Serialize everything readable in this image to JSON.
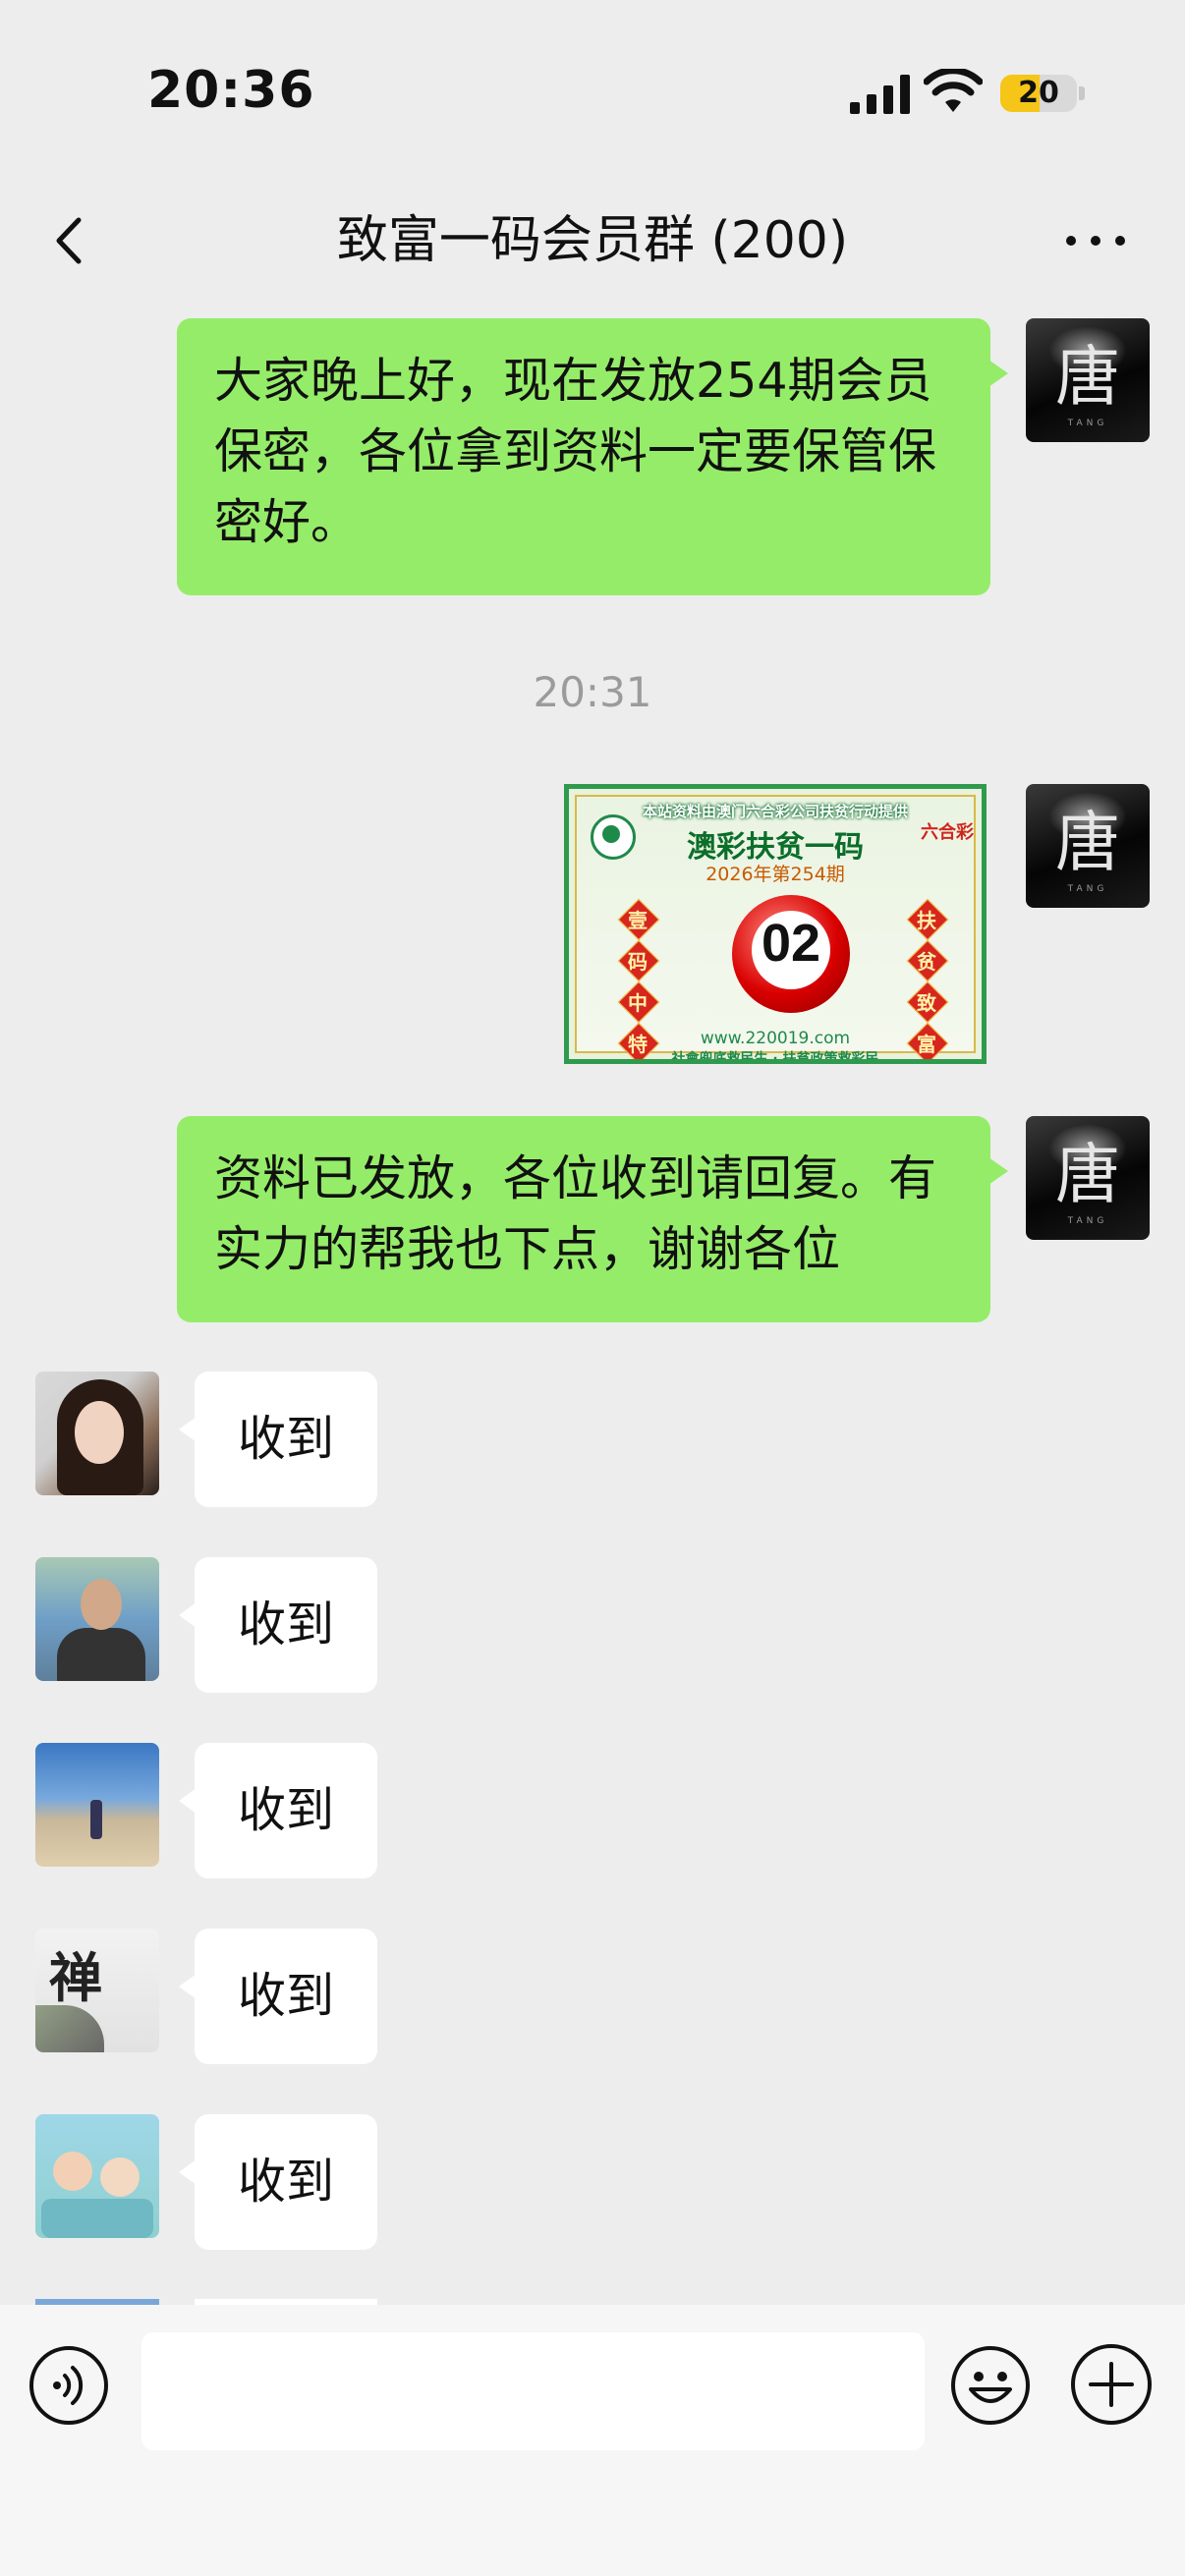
{
  "status_bar": {
    "time": "20:36",
    "battery": "20"
  },
  "nav": {
    "title": "致富一码会员群 (200)"
  },
  "messages": {
    "msg1": "大家晚上好，现在发放254期会员保密，各位拿到资料一定要保管保密好。",
    "timestamp": "20:31",
    "msg3": "资料已发放，各位收到请回复。有实力的帮我也下点，谢谢各位"
  },
  "poster": {
    "top_text": "本站资料由澳门六合彩公司扶贫行动提供",
    "title": "澳彩扶贫一码",
    "issue": "2026年第254期",
    "logo_text": "六合彩",
    "left_chars": [
      "壹",
      "码",
      "中",
      "特"
    ],
    "right_chars": [
      "扶",
      "贫",
      "致",
      "富"
    ],
    "number": "02",
    "url": "www.220019.com",
    "bottom_text": "社會兜底救民生 · 扶貧政策救彩民"
  },
  "sender": {
    "avatar_char": "唐",
    "avatar_sub": "TANG"
  },
  "replies": [
    {
      "text": "收到",
      "avatar": "user-avatar-woman"
    },
    {
      "text": "收到",
      "avatar": "user-avatar-man"
    },
    {
      "text": "收到",
      "avatar": "user-avatar-beach"
    },
    {
      "text": "收到",
      "avatar": "user-avatar-zen",
      "avatar_char": "禅"
    },
    {
      "text": "收到",
      "avatar": "user-avatar-kids"
    }
  ],
  "input": {
    "value": "",
    "placeholder": ""
  },
  "icons": {
    "back": "chevron-left-icon",
    "more": "more-dots-icon",
    "voice": "voice-icon",
    "emoji": "emoji-icon",
    "plus": "plus-icon"
  },
  "colors": {
    "background": "#ededed",
    "outgoing_bubble": "#95ec69",
    "incoming_bubble": "#ffffff",
    "battery_fill": "#f5c518"
  }
}
